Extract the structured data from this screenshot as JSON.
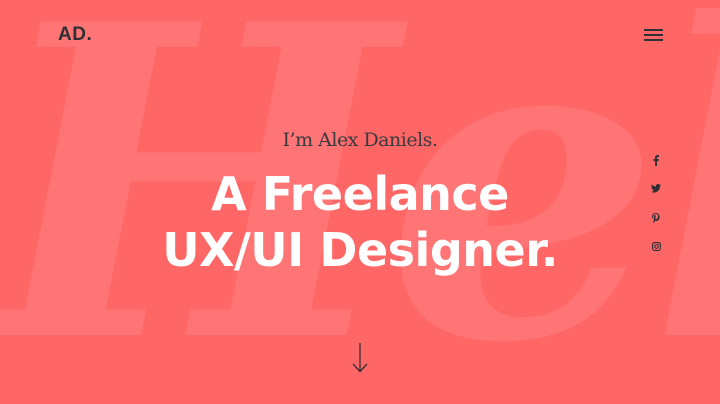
{
  "background_word": "Hello",
  "header": {
    "logo": "AD."
  },
  "hero": {
    "intro": "I’m Alex Daniels.",
    "headline_line1": "A Freelance",
    "headline_line2": "UX/UI Designer."
  },
  "social_links": [
    {
      "icon": "facebook-icon"
    },
    {
      "icon": "twitter-icon"
    },
    {
      "icon": "pinterest-icon"
    },
    {
      "icon": "instagram-icon"
    }
  ],
  "scroll_icon": "arrow-down-icon",
  "colors": {
    "background": "#ff6767",
    "text_dark": "#2f2f35",
    "text_light": "#ffffff"
  }
}
